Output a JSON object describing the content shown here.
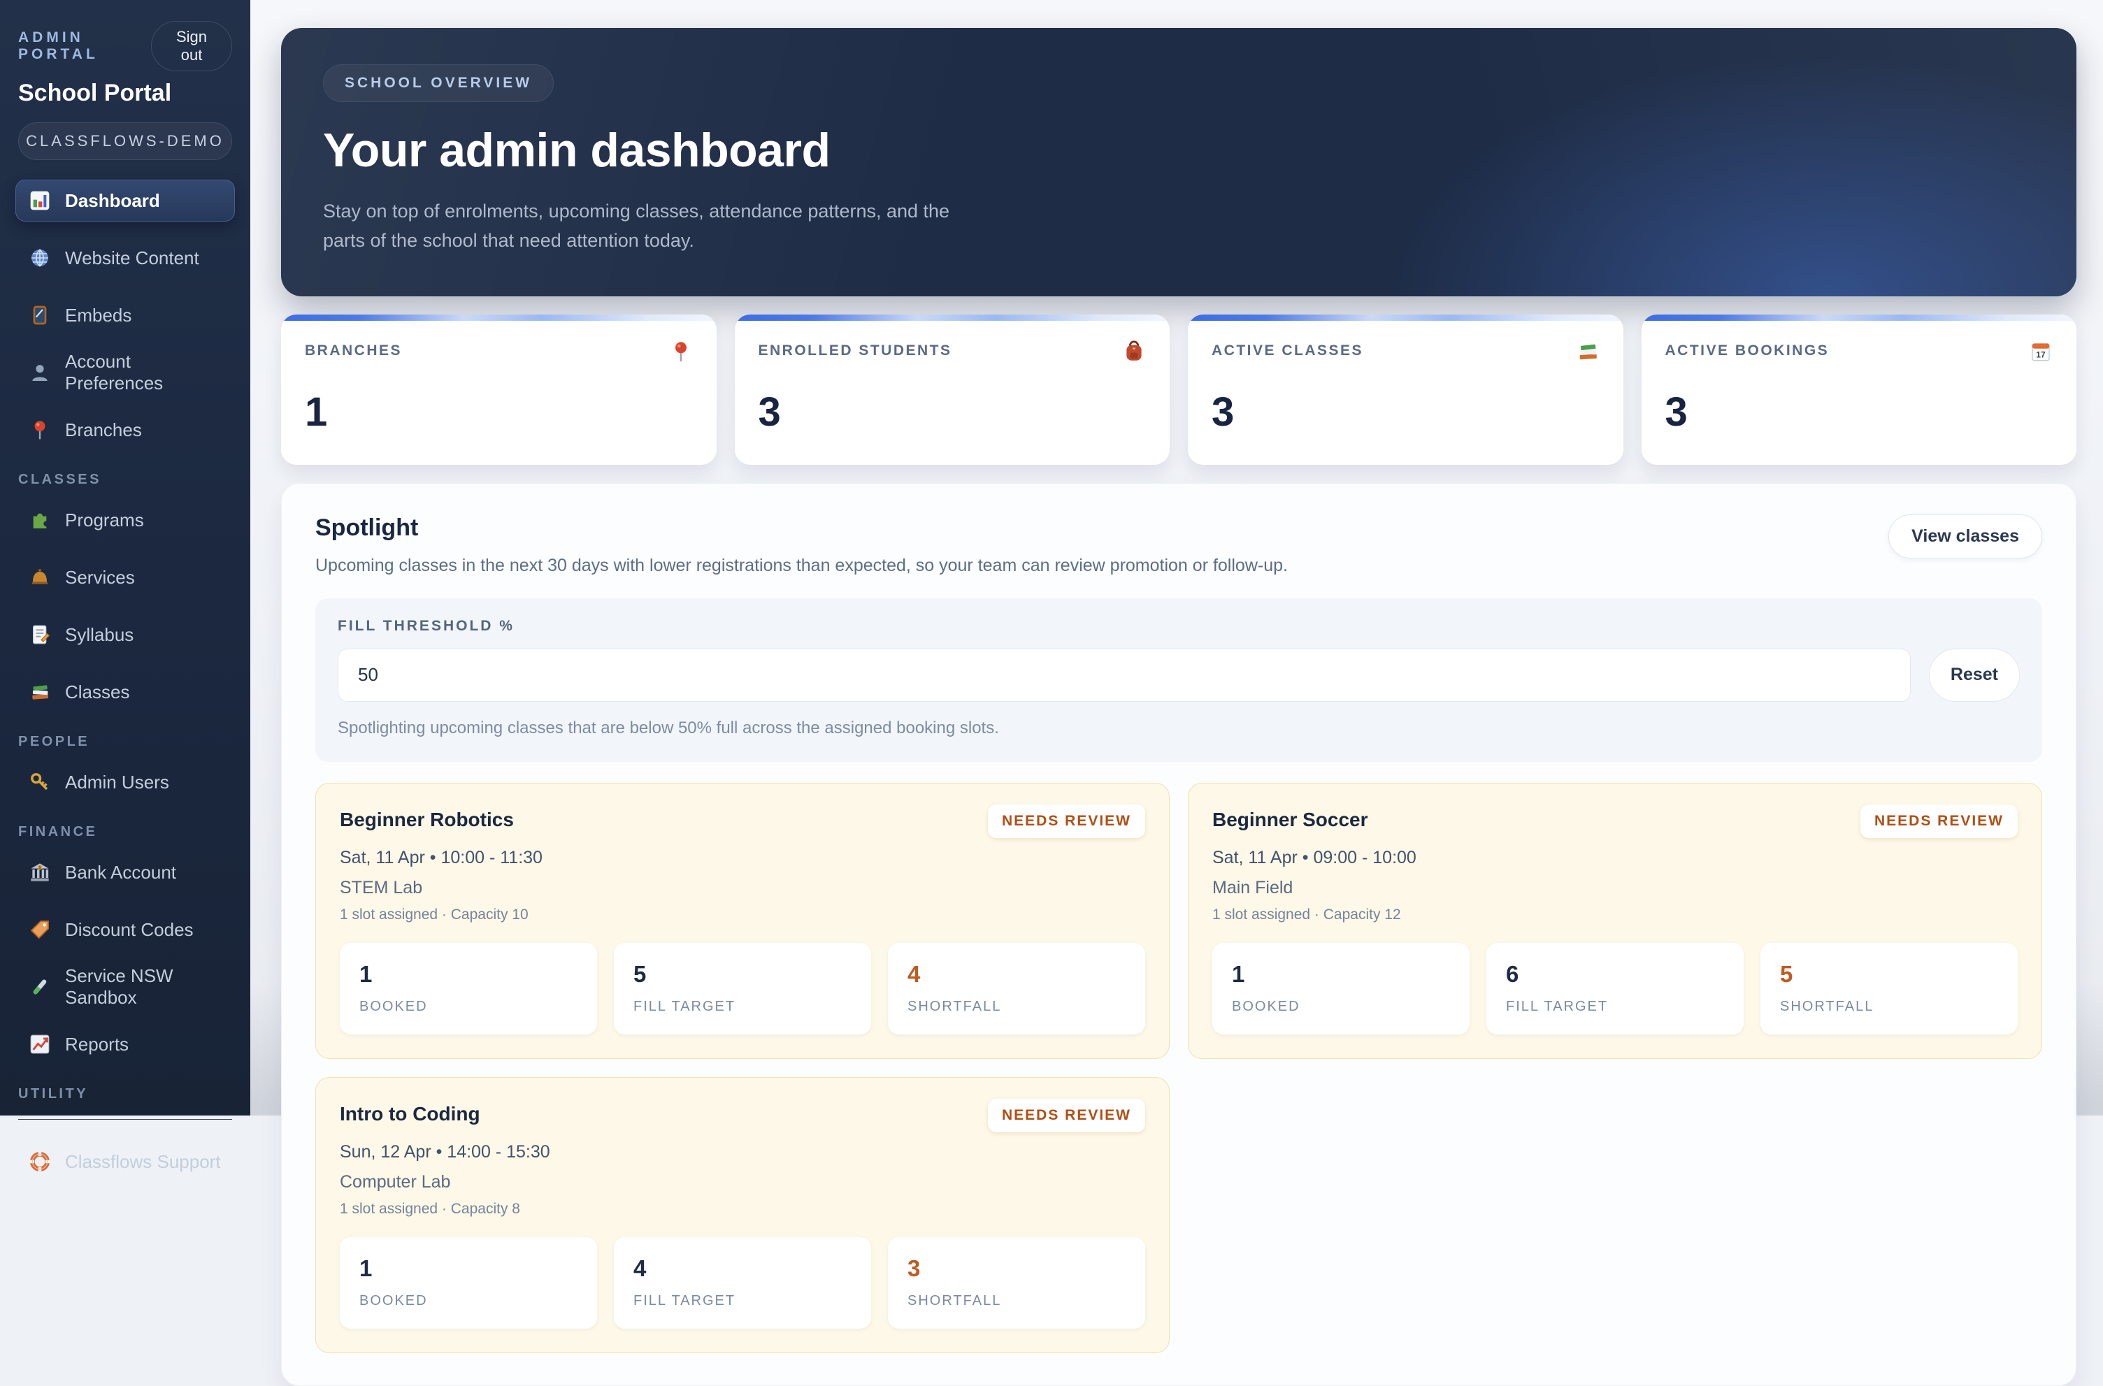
{
  "colors": {
    "sidebar_bg": "#1e2b43",
    "hero_bg": "#1e2c46",
    "accent_blue": "#3f6ce0",
    "warning_orange": "#bf5b21",
    "class_card_bg": "#fdf8e8"
  },
  "sidebar": {
    "kicker": "ADMIN PORTAL",
    "signout_label": "Sign out",
    "title": "School Portal",
    "tenant_badge": "CLASSFLOWS-DEMO",
    "sections": [
      {
        "items": [
          {
            "label": "Dashboard",
            "icon": "bar-chart-icon",
            "active": true
          },
          {
            "label": "Website Content",
            "icon": "globe-icon"
          },
          {
            "label": "Embeds",
            "icon": "window-icon"
          },
          {
            "label": "Account Preferences",
            "icon": "user-icon"
          },
          {
            "label": "Branches",
            "icon": "pushpin-icon"
          }
        ]
      },
      {
        "header": "CLASSES",
        "items": [
          {
            "label": "Programs",
            "icon": "puzzle-icon"
          },
          {
            "label": "Services",
            "icon": "bell-icon"
          },
          {
            "label": "Syllabus",
            "icon": "memo-icon"
          },
          {
            "label": "Classes",
            "icon": "books-icon"
          }
        ]
      },
      {
        "header": "PEOPLE",
        "items": [
          {
            "label": "Admin Users",
            "icon": "key-icon"
          }
        ]
      },
      {
        "header": "FINANCE",
        "items": [
          {
            "label": "Bank Account",
            "icon": "bank-icon"
          },
          {
            "label": "Discount Codes",
            "icon": "tag-icon"
          },
          {
            "label": "Service NSW Sandbox",
            "icon": "test-tube-icon"
          },
          {
            "label": "Reports",
            "icon": "chart-up-icon"
          }
        ]
      },
      {
        "header": "UTILITY",
        "items": [
          {
            "label": "Classflows Support",
            "icon": "life-ring-icon"
          }
        ]
      }
    ]
  },
  "hero": {
    "badge": "SCHOOL OVERVIEW",
    "title": "Your admin dashboard",
    "subtitle": "Stay on top of enrolments, upcoming classes, attendance patterns, and the parts of the school that need attention today."
  },
  "stats": [
    {
      "label": "BRANCHES",
      "value": "1",
      "icon": "pushpin-icon"
    },
    {
      "label": "ENROLLED STUDENTS",
      "value": "3",
      "icon": "backpack-icon"
    },
    {
      "label": "ACTIVE CLASSES",
      "value": "3",
      "icon": "books-icon"
    },
    {
      "label": "ACTIVE BOOKINGS",
      "value": "3",
      "icon": "calendar-icon"
    }
  ],
  "spotlight": {
    "title": "Spotlight",
    "view_classes_label": "View classes",
    "description": "Upcoming classes in the next 30 days with lower registrations than expected, so your team can review promotion or follow-up.",
    "threshold": {
      "label": "FILL THRESHOLD %",
      "value": "50",
      "reset_label": "Reset",
      "helper": "Spotlighting upcoming classes that are below 50% full across the assigned booking slots."
    },
    "cards": [
      {
        "title": "Beginner Robotics",
        "badge": "NEEDS REVIEW",
        "datetime": "Sat, 11 Apr • 10:00 - 11:30",
        "location": "STEM Lab",
        "capacity": "1 slot assigned · Capacity 10",
        "metrics": [
          {
            "value": "1",
            "label": "BOOKED"
          },
          {
            "value": "5",
            "label": "FILL TARGET"
          },
          {
            "value": "4",
            "label": "SHORTFALL"
          }
        ]
      },
      {
        "title": "Beginner Soccer",
        "badge": "NEEDS REVIEW",
        "datetime": "Sat, 11 Apr • 09:00 - 10:00",
        "location": "Main Field",
        "capacity": "1 slot assigned · Capacity 12",
        "metrics": [
          {
            "value": "1",
            "label": "BOOKED"
          },
          {
            "value": "6",
            "label": "FILL TARGET"
          },
          {
            "value": "5",
            "label": "SHORTFALL"
          }
        ]
      },
      {
        "title": "Intro to Coding",
        "badge": "NEEDS REVIEW",
        "datetime": "Sun, 12 Apr • 14:00 - 15:30",
        "location": "Computer Lab",
        "capacity": "1 slot assigned · Capacity 8",
        "metrics": [
          {
            "value": "1",
            "label": "BOOKED"
          },
          {
            "value": "4",
            "label": "FILL TARGET"
          },
          {
            "value": "3",
            "label": "SHORTFALL"
          }
        ]
      }
    ]
  }
}
